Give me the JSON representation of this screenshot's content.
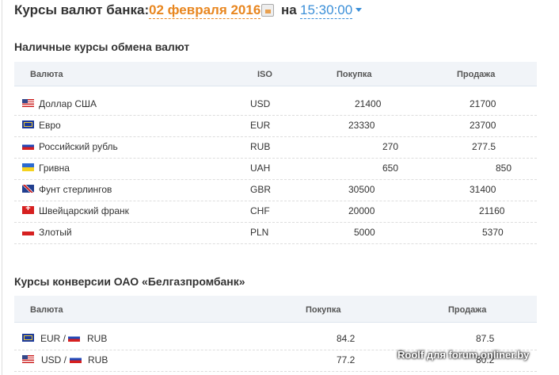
{
  "header": {
    "title": "Курсы валют банка:",
    "date": "02 февраля 2016",
    "on": "на",
    "time": "15:30:00"
  },
  "cash": {
    "title": "Наличные курсы обмена валют",
    "columns": [
      "Валюта",
      "ISO",
      "Покупка",
      "Продажа"
    ],
    "rows": [
      {
        "name": "Доллар США",
        "iso": "USD",
        "buy": "21400",
        "sell": "21700"
      },
      {
        "name": "Евро",
        "iso": "EUR",
        "buy": "23330",
        "sell": "23700"
      },
      {
        "name": "Российский рубль",
        "iso": "RUB",
        "buy": "270",
        "sell": "277.5"
      },
      {
        "name": "Гривна",
        "iso": "UAH",
        "buy": "650",
        "sell": "850"
      },
      {
        "name": "Фунт стерлингов",
        "iso": "GBR",
        "buy": "30500",
        "sell": "31400"
      },
      {
        "name": "Швейцарский франк",
        "iso": "CHF",
        "buy": "20000",
        "sell": "21160"
      },
      {
        "name": "Злотый",
        "iso": "PLN",
        "buy": "5000",
        "sell": "5370"
      }
    ]
  },
  "conv": {
    "title": "Курсы конверсии ОАО «Белгазпромбанк»",
    "columns": [
      "Валюта",
      "Покупка",
      "Продажа"
    ],
    "rows": [
      {
        "from": "EUR /",
        "to": "RUB",
        "buy": "84.2",
        "sell": "87.5"
      },
      {
        "from": "USD /",
        "to": "RUB",
        "buy": "77.2",
        "sell": "80.2"
      }
    ]
  },
  "watermark": "Roolf для forum.onliner.by"
}
